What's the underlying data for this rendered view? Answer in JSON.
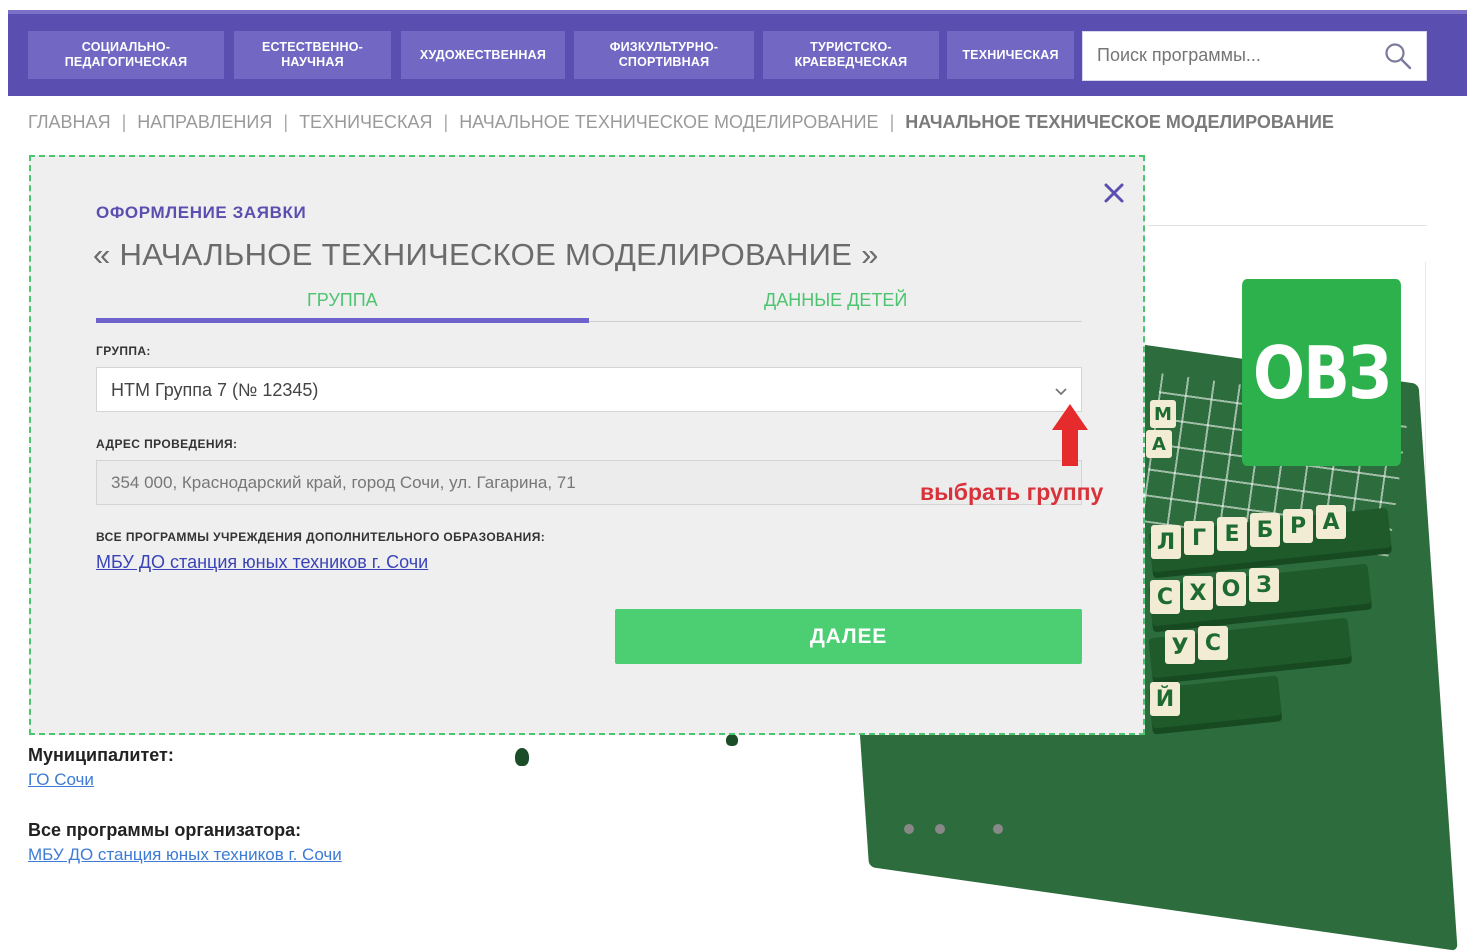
{
  "nav": {
    "items": [
      {
        "label": "СОЦИАЛЬНО-\nПЕДАГОГИЧЕСКАЯ"
      },
      {
        "label": "ЕСТЕСТВЕННО-\nНАУЧНАЯ"
      },
      {
        "label": "ХУДОЖЕСТВЕННАЯ"
      },
      {
        "label": "ФИЗКУЛЬТУРНО-\nСПОРТИВНАЯ"
      },
      {
        "label": "ТУРИСТСКО-\nКРАЕВЕДЧЕСКАЯ"
      },
      {
        "label": "ТЕХНИЧЕСКАЯ"
      }
    ],
    "search_placeholder": "Поиск программы..."
  },
  "breadcrumb": {
    "items": [
      "ГЛАВНАЯ",
      "НАПРАВЛЕНИЯ",
      "ТЕХНИЧЕСКАЯ",
      "НАЧАЛЬНОЕ ТЕХНИЧЕСКОЕ МОДЕЛИРОВАНИЕ"
    ],
    "current": "НАЧАЛЬНОЕ ТЕХНИЧЕСКОЕ МОДЕЛИРОВАНИЕ",
    "separator": "|"
  },
  "modal": {
    "subtitle": "ОФОРМЛЕНИЕ ЗАЯВКИ",
    "title": "« НАЧАЛЬНОЕ ТЕХНИЧЕСКОЕ МОДЕЛИРОВАНИЕ »",
    "tabs": [
      {
        "label": "ГРУППА",
        "active": true
      },
      {
        "label": "ДАННЫЕ ДЕТЕЙ",
        "active": false
      }
    ],
    "group_label": "ГРУППА:",
    "group_value": "НТМ Группа 7 (№ 12345)",
    "address_label": "АДРЕС ПРОВЕДЕНИЯ:",
    "address_value": "354 000, Краснодарский край, город Сочи, ул. Гагарина, 71",
    "all_programs_label": "ВСЕ ПРОГРАММЫ УЧРЕЖДЕНИЯ ДОПОЛНИТЕЛЬНОГО ОБРАЗОВАНИЯ:",
    "institution_link": "МБУ ДО станция юных техников г. Сочи",
    "next_button": "ДАЛЕЕ",
    "close_icon": "close-icon"
  },
  "annotation": {
    "text": "выбрать группу",
    "color": "#d8323a"
  },
  "page": {
    "badge": "ОВЗ",
    "municipality_label": "Муниципалитет:",
    "municipality_link": "ГО Сочи",
    "organizer_label": "Все программы организатора:",
    "organizer_link": "МБУ ДО станция юных техников г. Сочи",
    "tiles_row1": [
      "Л",
      "Г",
      "Е",
      "Б",
      "Р",
      "А"
    ],
    "tiles_row2": [
      "С",
      "Х",
      "О",
      "З"
    ],
    "tiles_row3": [
      "У",
      "С"
    ],
    "tiles_row4": [
      "Й"
    ],
    "tiles_side": [
      "М",
      "А"
    ]
  },
  "colors": {
    "nav_bg": "#5a4fb0",
    "nav_item": "#7268c4",
    "accent_green": "#4ccf73",
    "badge_green": "#2db14c",
    "tab_active": "#6f62cc"
  }
}
